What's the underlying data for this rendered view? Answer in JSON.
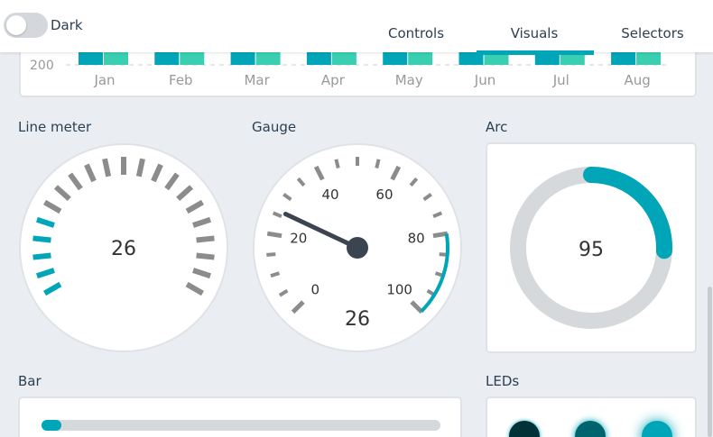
{
  "header": {
    "theme_toggle_label": "Dark",
    "tabs": [
      {
        "label": "Controls"
      },
      {
        "label": "Visuals"
      },
      {
        "label": "Selectors"
      }
    ],
    "active_tab": "Visuals"
  },
  "chart_data": {
    "type": "bar",
    "categories": [
      "Jan",
      "Feb",
      "Mar",
      "Apr",
      "May",
      "Jun",
      "Jul",
      "Aug"
    ],
    "y_tick_visible": "200",
    "series_colors": [
      "#00a6b8",
      "#39cfb0"
    ]
  },
  "line_meter": {
    "title": "Line meter",
    "value": "26",
    "value_num": 26,
    "max": 100
  },
  "gauge": {
    "title": "Gauge",
    "value": "26",
    "value_num": 26,
    "min": 0,
    "max": 100,
    "labels": [
      "0",
      "20",
      "40",
      "60",
      "80",
      "100"
    ],
    "critical_from": 80
  },
  "arc": {
    "title": "Arc",
    "value": "95",
    "value_num": 95
  },
  "bar": {
    "title": "Bar",
    "value_num": 5,
    "max": 100
  },
  "leds": {
    "title": "LEDs",
    "brightness": [
      0.3,
      0.6,
      1.0
    ]
  },
  "colors": {
    "accent": "#00a6b8",
    "tick_gray": "#8c8c8c",
    "track_gray": "#d6d9dc",
    "needle": "#3d4451"
  }
}
